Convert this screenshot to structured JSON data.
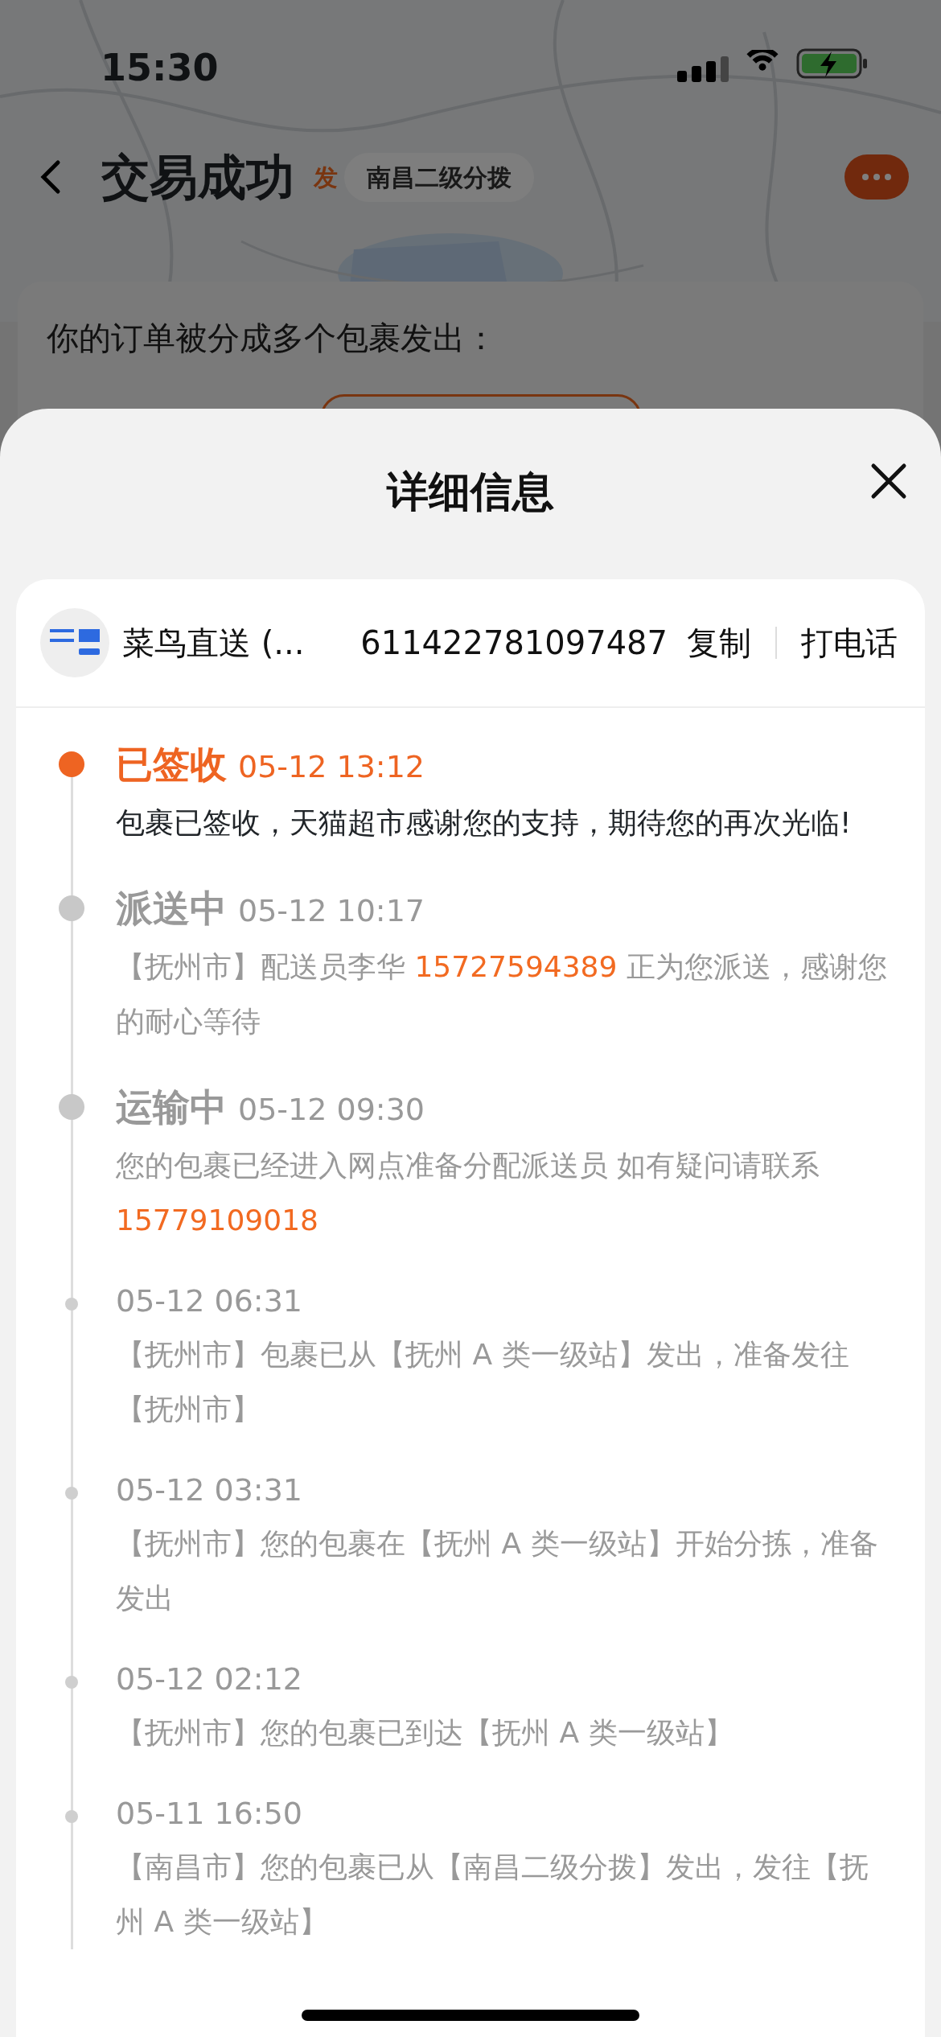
{
  "status_bar": {
    "time": "15:30"
  },
  "header": {
    "title": "交易成功",
    "map_chip": {
      "badge": "发",
      "label": "南昌二级分拨"
    }
  },
  "order_card": {
    "text": "你的订单被分成多个包裹发出："
  },
  "sheet": {
    "title": "详细信息",
    "carrier": {
      "name": "菜鸟直送 (...",
      "tracking_number": "611422781097487",
      "copy": "复制",
      "call": "打电话"
    },
    "events": [
      {
        "kind": "major",
        "current": true,
        "status": "已签收",
        "time": "05-12 13:12",
        "desc": [
          {
            "kind": "plain",
            "text": "包裹已签收，天猫超市感谢您的支持，期待您的再次光临!"
          }
        ]
      },
      {
        "kind": "major",
        "current": false,
        "status": "派送中",
        "time": "05-12 10:17",
        "desc": [
          {
            "kind": "plain",
            "text": "【抚州市】配送员李华 "
          },
          {
            "kind": "phone",
            "text": "15727594389"
          },
          {
            "kind": "plain",
            "text": " 正为您派送，感谢您的耐心等待"
          }
        ]
      },
      {
        "kind": "major",
        "current": false,
        "status": "运输中",
        "time": "05-12 09:30",
        "desc": [
          {
            "kind": "plain",
            "text": "您的包裹已经进入网点准备分配派送员 如有疑问请联系 "
          },
          {
            "kind": "phone",
            "text": "15779109018"
          }
        ]
      },
      {
        "kind": "minor",
        "current": false,
        "time": "05-12 06:31",
        "desc": [
          {
            "kind": "plain",
            "text": "【抚州市】包裹已从【抚州 A 类一级站】发出，准备发往【抚州市】"
          }
        ]
      },
      {
        "kind": "minor",
        "current": false,
        "time": "05-12 03:31",
        "desc": [
          {
            "kind": "plain",
            "text": "【抚州市】您的包裹在【抚州 A 类一级站】开始分拣，准备发出"
          }
        ]
      },
      {
        "kind": "minor",
        "current": false,
        "time": "05-12 02:12",
        "desc": [
          {
            "kind": "plain",
            "text": "【抚州市】您的包裹已到达【抚州 A 类一级站】"
          }
        ]
      },
      {
        "kind": "minor",
        "current": false,
        "time": "05-11 16:50",
        "desc": [
          {
            "kind": "plain",
            "text": "【南昌市】您的包裹已从【南昌二级分拨】发出，发往【抚州 A 类一级站】"
          }
        ]
      }
    ]
  }
}
